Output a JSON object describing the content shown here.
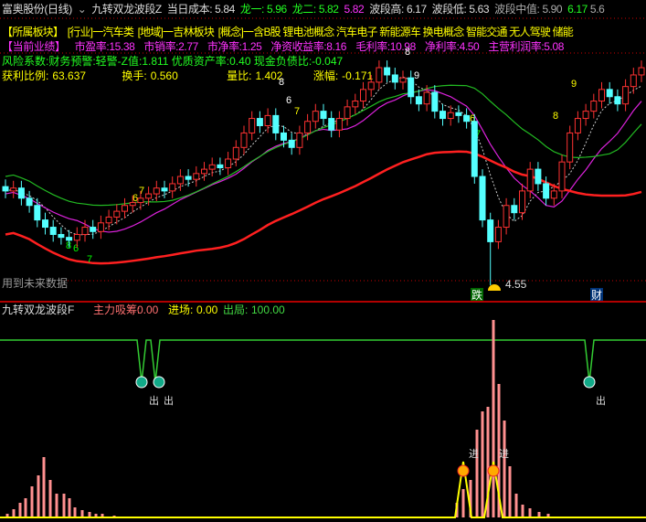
{
  "header": {
    "title": "富奥股份(日线)",
    "indicator": "九转双龙波段Z",
    "cost_label": "当日成本:",
    "cost": "5.84",
    "long1_label": "龙一:",
    "long1": "5.96",
    "long2_label": "龙二:",
    "long2": "5.82",
    "long2b": "5.82",
    "high_label": "波段高:",
    "high": "6.17",
    "low_label": "波段低:",
    "low": "5.63",
    "mid_label": "波段中值:",
    "mid": "5.90",
    "mid2": "6.17",
    "mid3": "5.6"
  },
  "sectors": [
    "【所属板块】",
    "[行业]一汽车类",
    "[地域]一吉林板块",
    "[概念]一含B股 锂电池概念 汽车电子 新能源车 换电概念 智能交通 无人驾驶 储能"
  ],
  "perf": [
    "【当前业绩】",
    "市盈率:15.38",
    "市销率:2.77",
    "市净率:1.25",
    "净资收益率:8.16",
    "毛利率:10.98",
    "净利率:4.50",
    "主营利润率:5.08"
  ],
  "risk": "风险系数:财务预警:轻警-Z值:1.811 优质资产率:0.40 现金负债比:-0.047",
  "stats": [
    {
      "label": "获利比例:",
      "value": "63.637"
    },
    {
      "label": "换手:",
      "value": "0.560"
    },
    {
      "label": "量比:",
      "value": "1.402"
    },
    {
      "label": "涨幅:",
      "value": "-0.171"
    }
  ],
  "future_note": "用到未来数据",
  "low_marker": "4.55",
  "badges": {
    "drop": "跌",
    "finance": "财"
  },
  "nine_labels": [
    "6",
    "7",
    "8",
    "6",
    "7",
    "8",
    "6",
    "7",
    "8",
    "9",
    "6",
    "7",
    "8",
    "9"
  ],
  "lower": {
    "title": "九转双龙波段F",
    "accumulate_label": "主力吸筹:",
    "accumulate": "0.00",
    "entry_label": "进场:",
    "entry": "0.00",
    "exit_label": "出局:",
    "exit": "100.00",
    "exit_mark": "出",
    "entry_mark": "进"
  },
  "colors": {
    "up": "#ff3232",
    "down": "#54ffff",
    "ma_red": "#ff2020",
    "ma_green": "#22bb22",
    "ma_magenta": "#dd22dd"
  },
  "chart_data": {
    "type": "candlestick",
    "price_range": [
      4.55,
      6.17
    ],
    "closes": [
      5.2,
      5.22,
      5.15,
      5.1,
      5.0,
      4.95,
      4.9,
      4.88,
      4.86,
      4.9,
      4.95,
      4.92,
      4.98,
      5.02,
      5.06,
      5.1,
      5.12,
      5.15,
      5.18,
      5.22,
      5.2,
      5.25,
      5.3,
      5.28,
      5.32,
      5.35,
      5.38,
      5.36,
      5.42,
      5.5,
      5.6,
      5.7,
      5.65,
      5.72,
      5.6,
      5.55,
      5.5,
      5.6,
      5.68,
      5.75,
      5.7,
      5.62,
      5.7,
      5.78,
      5.82,
      5.9,
      5.95,
      6.05,
      6.0,
      5.95,
      5.98,
      5.85,
      5.8,
      5.88,
      5.75,
      5.7,
      5.74,
      5.72,
      5.68,
      5.3,
      5.0,
      4.85,
      4.95,
      5.1,
      5.05,
      5.2,
      5.35,
      5.25,
      5.15,
      5.2,
      5.4,
      5.6,
      5.7,
      5.75,
      5.82,
      5.9,
      5.85,
      5.8,
      5.92,
      6.0,
      6.05
    ]
  }
}
